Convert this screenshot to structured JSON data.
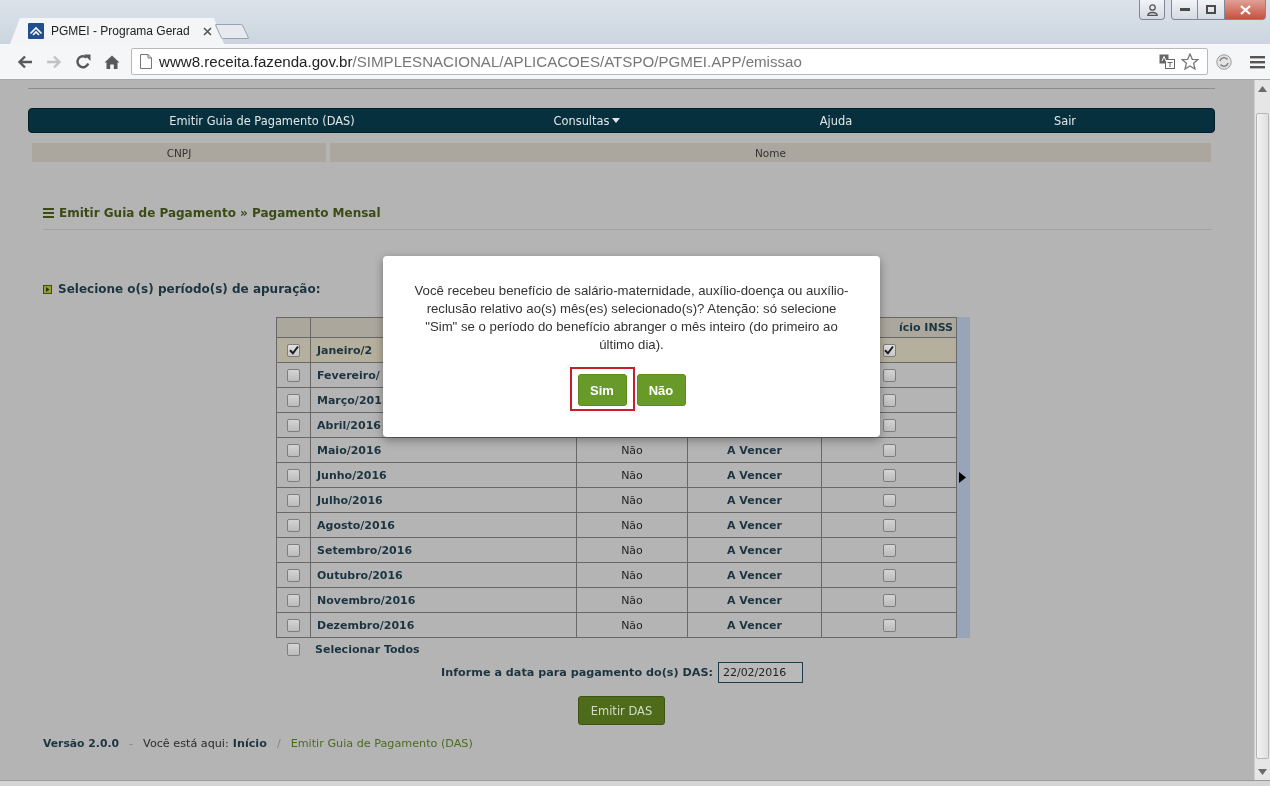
{
  "browser": {
    "tab_title": "PGMEI - Programa Gerad",
    "url_host": "www8.receita.fazenda.gov.br",
    "url_path": "/SIMPLESNACIONAL/APLICACOES/ATSPO/PGMEI.APP/emissao",
    "forward_disabled": true
  },
  "nav": [
    {
      "label": "Emitir Guia de Pagamento (DAS)",
      "dropdown": false
    },
    {
      "label": "Consultas",
      "dropdown": true
    },
    {
      "label": "Ajuda",
      "dropdown": false
    },
    {
      "label": "Sair",
      "dropdown": false
    }
  ],
  "info_table": {
    "columns": [
      "CNPJ",
      "Nome"
    ]
  },
  "heading": "Emitir Guia de Pagamento » Pagamento Mensal",
  "period_prompt": "Selecione o(s) período(s) de apuração:",
  "table": {
    "column_5_header": "ício INSS",
    "rows": [
      {
        "checked": true,
        "period": "Janeiro/2",
        "inss_checked": true
      },
      {
        "checked": false,
        "period": "Fevereiro/",
        "inss_checked": false
      },
      {
        "checked": false,
        "period": "Março/201",
        "inss_checked": false
      },
      {
        "checked": false,
        "period": "Abril/2016",
        "inss_checked": false
      },
      {
        "checked": false,
        "period": "Maio/2016",
        "column_3": "Não",
        "column_4": "A Vencer",
        "inss_checked": false
      },
      {
        "checked": false,
        "period": "Junho/2016",
        "column_3": "Não",
        "column_4": "A Vencer",
        "inss_checked": false
      },
      {
        "checked": false,
        "period": "Julho/2016",
        "column_3": "Não",
        "column_4": "A Vencer",
        "inss_checked": false
      },
      {
        "checked": false,
        "period": "Agosto/2016",
        "column_3": "Não",
        "column_4": "A Vencer",
        "inss_checked": false
      },
      {
        "checked": false,
        "period": "Setembro/2016",
        "column_3": "Não",
        "column_4": "A Vencer",
        "inss_checked": false
      },
      {
        "checked": false,
        "period": "Outubro/2016",
        "column_3": "Não",
        "column_4": "A Vencer",
        "inss_checked": false
      },
      {
        "checked": false,
        "period": "Novembro/2016",
        "column_3": "Não",
        "column_4": "A Vencer",
        "inss_checked": false
      },
      {
        "checked": false,
        "period": "Dezembro/2016",
        "column_3": "Não",
        "column_4": "A Vencer",
        "inss_checked": false
      }
    ]
  },
  "select_all": {
    "label": "Selecionar Todos",
    "checked": false
  },
  "payment_date": {
    "label": "Informe a data para pagamento do(s) DAS:",
    "value": "22/02/2016"
  },
  "submit_button": "Emitir DAS",
  "footer": {
    "version": "Versão 2.0.0",
    "separator": "-",
    "location_label": "Você está aqui:",
    "breadcrumb_separator": "/",
    "breadcrumbs": [
      {
        "label": "Início",
        "current": false
      },
      {
        "label": "Emitir Guia de Pagamento (DAS)",
        "current": true
      }
    ]
  },
  "dialog": {
    "message": "Você recebeu benefício de salário-maternidade, auxílio-doença ou auxílio-reclusão relativo ao(s) mês(es) selecionado(s)? Atenção: só selecione \"Sim\" se o período do benefício abranger o mês inteiro (do primeiro ao último dia).",
    "buttons": [
      {
        "label": "Sim",
        "highlighted": true
      },
      {
        "label": "Não",
        "highlighted": false
      }
    ]
  }
}
